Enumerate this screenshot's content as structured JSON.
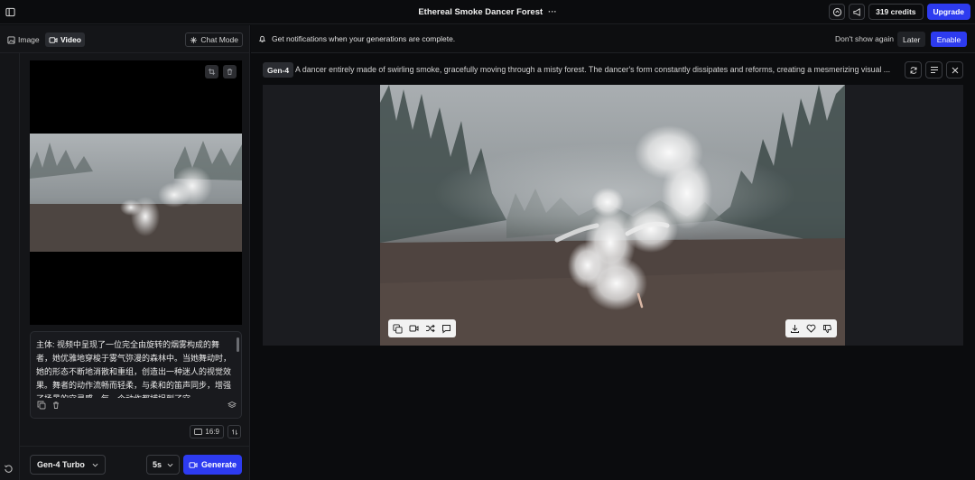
{
  "app": {
    "title": "Ethereal Smoke Dancer Forest",
    "title_menu": "···",
    "credits": "319 credits",
    "upgrade_label": "Upgrade"
  },
  "modes": {
    "image_label": "Image",
    "video_label": "Video",
    "chat_mode_label": "Chat Mode",
    "active": "Video"
  },
  "notification": {
    "text": "Get notifications when your generations are complete.",
    "dismiss_label": "Don't show again",
    "later_label": "Later",
    "enable_label": "Enable"
  },
  "prompt_panel": {
    "prompt_text": "主体: 视频中呈现了一位完全由旋转的烟雾构成的舞者，她优雅地穿梭于雾气弥漫的森林中。当她舞动时，她的形态不断地消散和重组，创造出一种迷人的视觉效果。舞者的动作流畅而轻柔，与柔和的笛声同步，增强了场景的空灵感。每一个动作都捕捉到了空",
    "aspect_ratio": "16:9",
    "model": "Gen-4 Turbo",
    "duration": "5s",
    "generate_label": "Generate"
  },
  "generation": {
    "model_badge": "Gen-4",
    "prompt": "A dancer entirely made of swirling smoke, gracefully moving through a misty forest. The dancer's form constantly dissipates and reforms, creating a mesmerizing visual ..."
  },
  "colors": {
    "accent": "#2d3bf0",
    "background": "#0b0c0e",
    "panel": "#141518"
  },
  "icons": {
    "sidebar_toggle": "sidebar-toggle-icon",
    "feedback": "chat-bubble-icon",
    "announce": "megaphone-icon",
    "bell": "bell-icon",
    "download": "download-icon",
    "like": "heart-icon",
    "dislike": "thumbs-down-icon"
  }
}
